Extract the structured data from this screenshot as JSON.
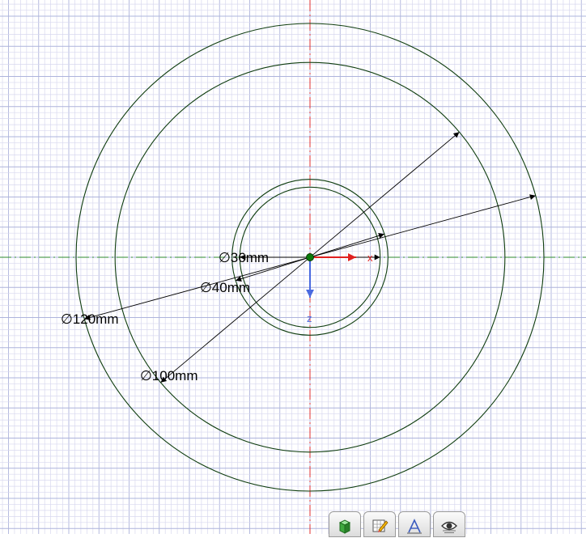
{
  "sketch": {
    "circles": [
      {
        "diameter": 120,
        "label": "∅120mm"
      },
      {
        "diameter": 100,
        "label": "∅100mm"
      },
      {
        "diameter": 40,
        "label": "∅40mm"
      },
      {
        "diameter": 36,
        "label": "∅36mm"
      }
    ],
    "axes": {
      "x_label": "x",
      "z_label": "z"
    }
  },
  "toolbar": {
    "items": [
      {
        "name": "solid-view-button",
        "icon": "green-box-icon"
      },
      {
        "name": "sketch-edit-button",
        "icon": "pencil-grid-icon"
      },
      {
        "name": "dimension-button",
        "icon": "dimension-icon"
      },
      {
        "name": "visibility-button",
        "icon": "eye-icon"
      }
    ]
  },
  "colors": {
    "grid_minor": "#d8d8ef",
    "grid_major": "#aeb4dc",
    "circle": "#0f3d0f",
    "axis_h": "#2e8b2e",
    "axis_v": "#e03030",
    "x_arrow": "#e02020",
    "z_arrow": "#4a6ae0",
    "origin": "#0a7a0a"
  }
}
